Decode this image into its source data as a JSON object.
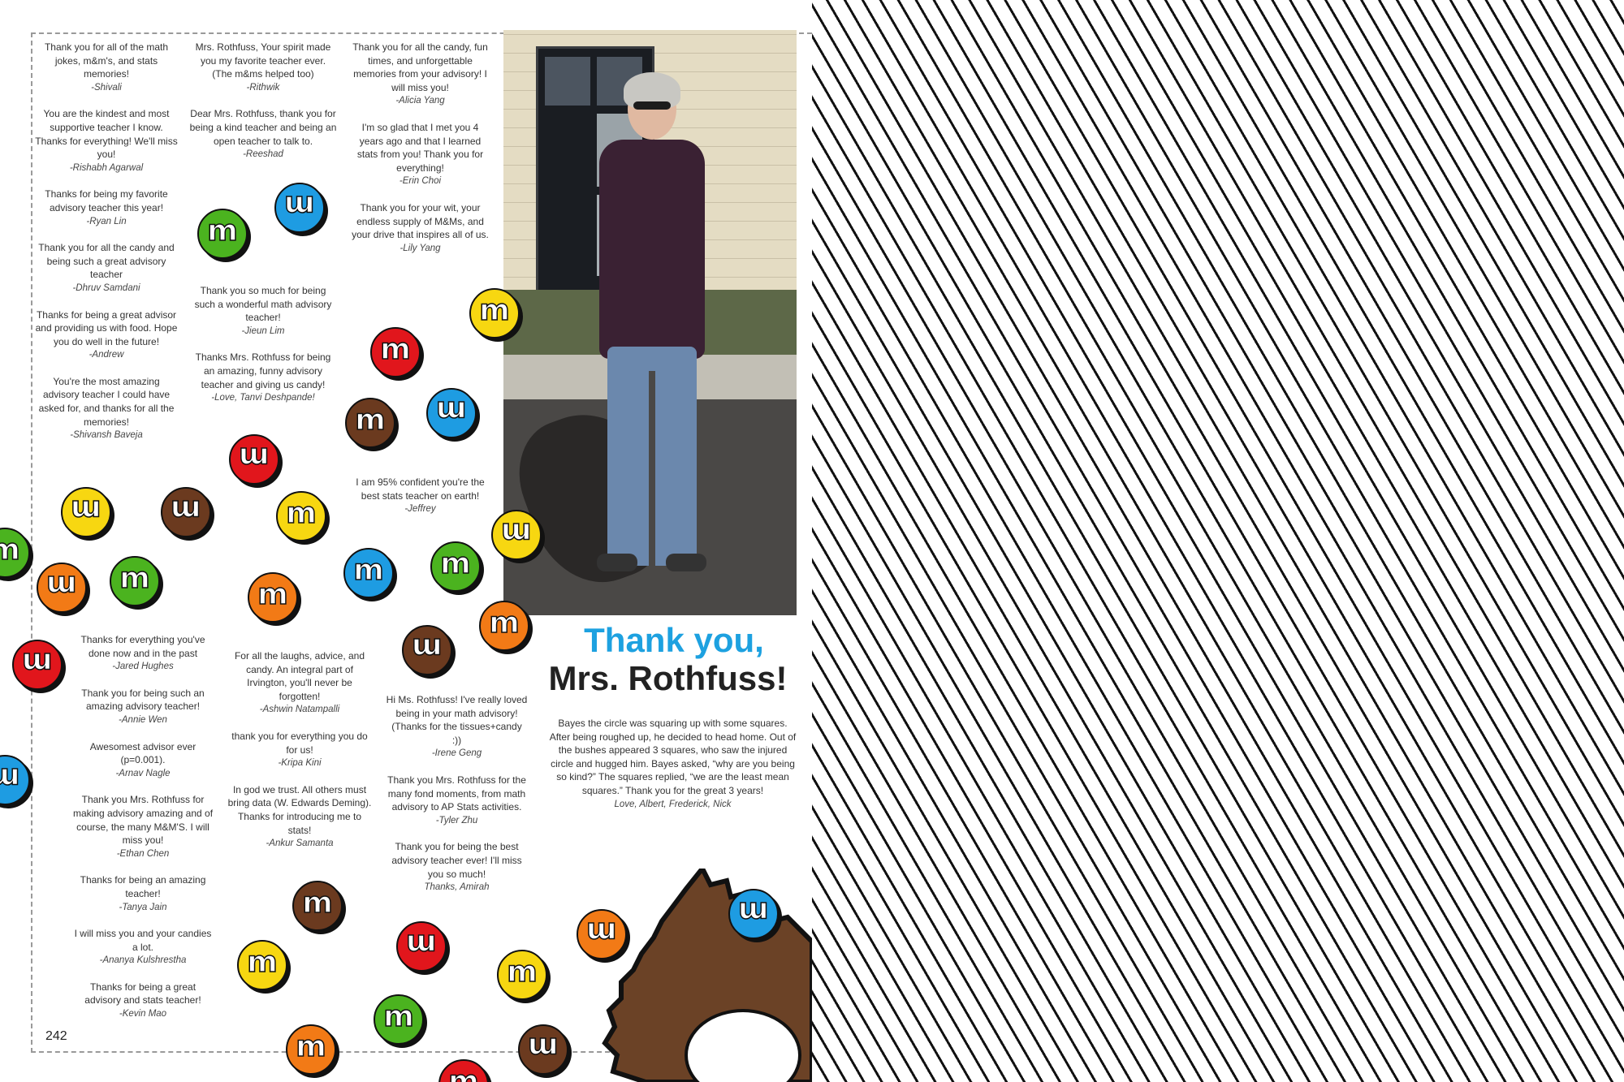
{
  "page_number": "242",
  "title_line1": "Thank you,",
  "title_line2": "Mrs. Rothfuss!",
  "col1_top": [
    {
      "text": "Thank you for all of the math jokes, m&m's, and stats memories!",
      "sig": "-Shivali"
    },
    {
      "text": "You are the kindest and most supportive teacher I know. Thanks for everything! We'll miss you!",
      "sig": "-Rishabh Agarwal"
    },
    {
      "text": "Thanks for being my favorite advisory teacher this year!",
      "sig": "-Ryan Lin"
    },
    {
      "text": "Thank you for all the candy and being such a great advisory teacher",
      "sig": "-Dhruv Samdani"
    },
    {
      "text": "Thanks for being a great advisor and providing us with food. Hope you do well in the future!",
      "sig": "-Andrew"
    },
    {
      "text": "You're the most amazing advisory teacher I could have asked for, and thanks for all the memories!",
      "sig": "-Shivansh Baveja"
    }
  ],
  "col2_top": [
    {
      "text": "Mrs. Rothfuss, Your spirit made you my favorite teacher ever. (The m&ms helped too)",
      "sig": "-Rithwik"
    },
    {
      "text": "Dear Mrs. Rothfuss, thank you for being a kind teacher and being an open teacher to talk to.",
      "sig": "-Reeshad"
    }
  ],
  "col2_mid": [
    {
      "text": "Thank you so much for being such a wonderful math advisory teacher!",
      "sig": "-Jieun Lim"
    },
    {
      "text": "Thanks Mrs. Rothfuss for being an amazing, funny advisory teacher and giving us candy!",
      "sig": "-Love, Tanvi Deshpande!"
    }
  ],
  "col3_top": [
    {
      "text": "Thank you for all the candy, fun times, and unforgettable memories from your advisory! I will miss you!",
      "sig": "-Alicia Yang"
    },
    {
      "text": "I'm so glad that I met you 4 years ago and that I learned stats from you! Thank you for everything!",
      "sig": "-Erin Choi"
    },
    {
      "text": "Thank you for your wit, your endless supply of M&Ms, and your drive that inspires all of us.",
      "sig": "-Lily Yang"
    }
  ],
  "col3_mid": [
    {
      "text": "I am 95% confident you're the best stats teacher on earth!",
      "sig": "-Jeffrey"
    }
  ],
  "col1_bottom": [
    {
      "text": "Thanks for everything you've done now and in the past",
      "sig": "-Jared Hughes"
    },
    {
      "text": "Thank you for being such an amazing advisory teacher!",
      "sig": "-Annie Wen"
    },
    {
      "text": "Awesomest advisor ever (p=0.001).",
      "sig": "-Arnav Nagle"
    },
    {
      "text": "Thank you Mrs. Rothfuss for making advisory amazing and of course, the many M&M'S. I will miss you!",
      "sig": "-Ethan Chen"
    },
    {
      "text": "Thanks for being an amazing teacher!",
      "sig": "-Tanya Jain"
    },
    {
      "text": "I will miss you and your candies a lot.",
      "sig": "-Ananya Kulshrestha"
    },
    {
      "text": "Thanks for being a great advisory and stats teacher!",
      "sig": "-Kevin Mao"
    }
  ],
  "col2_bottom": [
    {
      "text": "For all the laughs, advice, and candy. An integral part of Irvington, you'll never be forgotten!",
      "sig": "-Ashwin Natampalli"
    },
    {
      "text": "thank you for everything you do for us!",
      "sig": "-Kripa Kini"
    },
    {
      "text": "In god we trust. All others must bring data (W. Edwards Deming). Thanks for introducing me to stats!",
      "sig": "-Ankur Samanta"
    }
  ],
  "col3_bottom": [
    {
      "text": "Hi Ms. Rothfuss! I've really loved being in your math advisory! (Thanks for the tissues+candy :))",
      "sig": "-Irene Geng"
    },
    {
      "text": "Thank you Mrs. Rothfuss for the many fond moments, from math advisory to AP Stats activities.",
      "sig": "-Tyler Zhu"
    },
    {
      "text": "Thank you for being the best advisory teacher ever! I'll miss you so much!",
      "sig": "Thanks, Amirah"
    }
  ],
  "story": {
    "text": "Bayes the circle was squaring up with some squares. After being roughed up, he decided to head home. Out of the bushes appeared 3 squares, who saw the injured circle and hugged him. Bayes asked, “why are you being so kind?” The squares replied, “we are the least mean squares.” Thank you for the great 3 years!",
    "sig": "Love, Albert, Frederick, Nick"
  },
  "candy_letter": "m",
  "colors": {
    "title_blue": "#1da1e0",
    "red": "#e1161c",
    "blue": "#1e9ce2",
    "green": "#4bb31f",
    "yellow": "#f7d711",
    "orange": "#f27a16",
    "brown": "#6b3a1f"
  }
}
